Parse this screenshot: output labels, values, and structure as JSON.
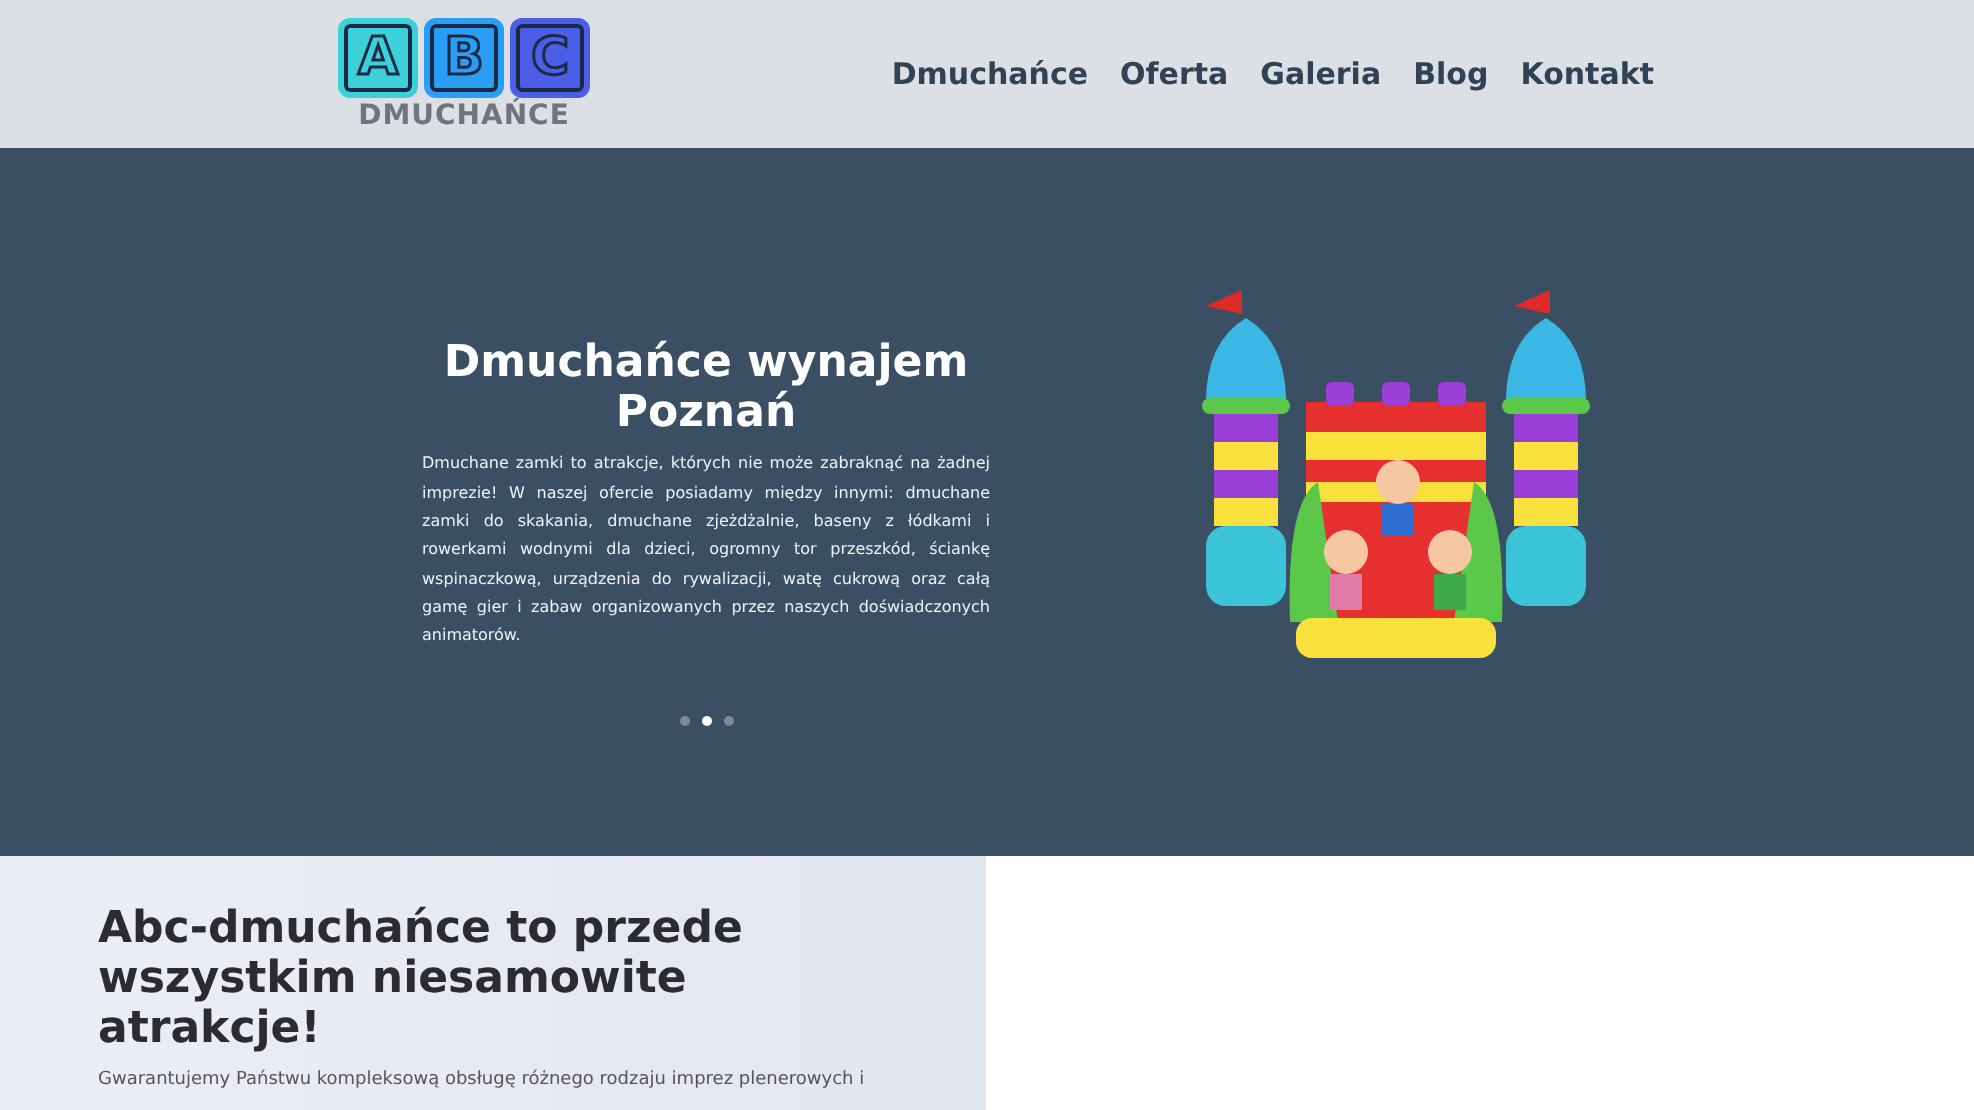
{
  "header": {
    "logo": {
      "letters": [
        "A",
        "B",
        "C"
      ],
      "wordmark": "DMUCHAŃCE"
    },
    "nav": [
      {
        "label": "Dmuchańce"
      },
      {
        "label": "Oferta"
      },
      {
        "label": "Galeria"
      },
      {
        "label": "Blog"
      },
      {
        "label": "Kontakt"
      }
    ]
  },
  "hero": {
    "title": "Dmuchańce wynajem Poznań",
    "text": "Dmuchane zamki to atrakcje, których nie może zabraknąć na żadnej imprezie! W naszej ofercie posiadamy między innymi: dmuchane zamki do skakania, dmuchane zjeżdżalnie, baseny z łódkami i rowerkami wodnymi dla dzieci, ogromny tor przeszkód, ściankę wspinaczkową, urządzenia do rywalizacji, watę cukrową oraz całą gamę gier i zabaw organizowanych przez naszych doświadczonych animatorów.",
    "dots": [
      {
        "selected": false
      },
      {
        "selected": true
      },
      {
        "selected": false
      }
    ]
  },
  "intro": {
    "heading": "Abc-dmuchańce to przede wszystkim niesamowite atrakcje!",
    "text": "Gwarantujemy Państwu kompleksową obsługę różnego rodzaju imprez plenerowych i"
  }
}
